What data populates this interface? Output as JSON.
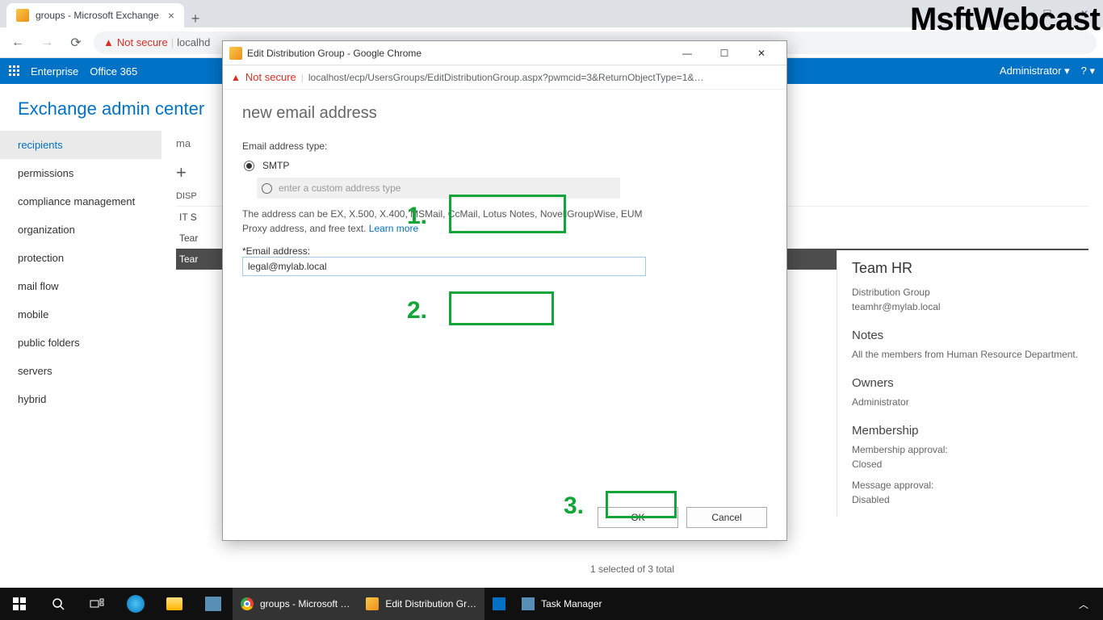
{
  "watermark": "MsftWebcast",
  "browser": {
    "tab_title": "groups - Microsoft Exchange",
    "not_secure": "Not secure",
    "url_visible": "localhd"
  },
  "exchange": {
    "header_left": [
      "Enterprise",
      "Office 365"
    ],
    "header_right_user": "Administrator",
    "title": "Exchange admin center",
    "sidebar": [
      "recipients",
      "permissions",
      "compliance management",
      "organization",
      "protection",
      "mail flow",
      "mobile",
      "public folders",
      "servers",
      "hybrid"
    ],
    "main": {
      "tab_partial": "ma",
      "toolbar_plus": "+",
      "list_header": "DISP",
      "rows": [
        "IT S",
        "Tear",
        "Tear"
      ],
      "status": "1 selected of 3 total"
    },
    "details": {
      "title": "Team HR",
      "type": "Distribution Group",
      "email": "teamhr@mylab.local",
      "sections": {
        "notes_h": "Notes",
        "notes": "All the members from Human Resource Department.",
        "owners_h": "Owners",
        "owners": "Administrator",
        "membership_h": "Membership",
        "m_approval_l": "Membership approval:",
        "m_approval_v": "Closed",
        "msg_approval_l": "Message approval:",
        "msg_approval_v": "Disabled"
      }
    }
  },
  "popup": {
    "window_title": "Edit Distribution Group - Google Chrome",
    "not_secure": "Not secure",
    "url": "localhost/ecp/UsersGroups/EditDistributionGroup.aspx?pwmcid=3&ReturnObjectType=1&…",
    "heading": "new email address",
    "type_label": "Email address type:",
    "smtp_label": "SMTP",
    "custom_placeholder": "enter a custom address type",
    "help": "The address can be EX, X.500, X.400, MSMail, CcMail, Lotus Notes, NovellGroupWise, EUM Proxy address, and free text.",
    "learn_more": "Learn more",
    "email_label": "*Email address:",
    "email_value": "legal@mylab.local",
    "ok": "OK",
    "cancel": "Cancel"
  },
  "callouts": {
    "n1": "1.",
    "n2": "2.",
    "n3": "3."
  },
  "taskbar": {
    "apps": [
      "groups - Microsoft …",
      "Edit Distribution Gr…",
      "Task Manager"
    ]
  }
}
